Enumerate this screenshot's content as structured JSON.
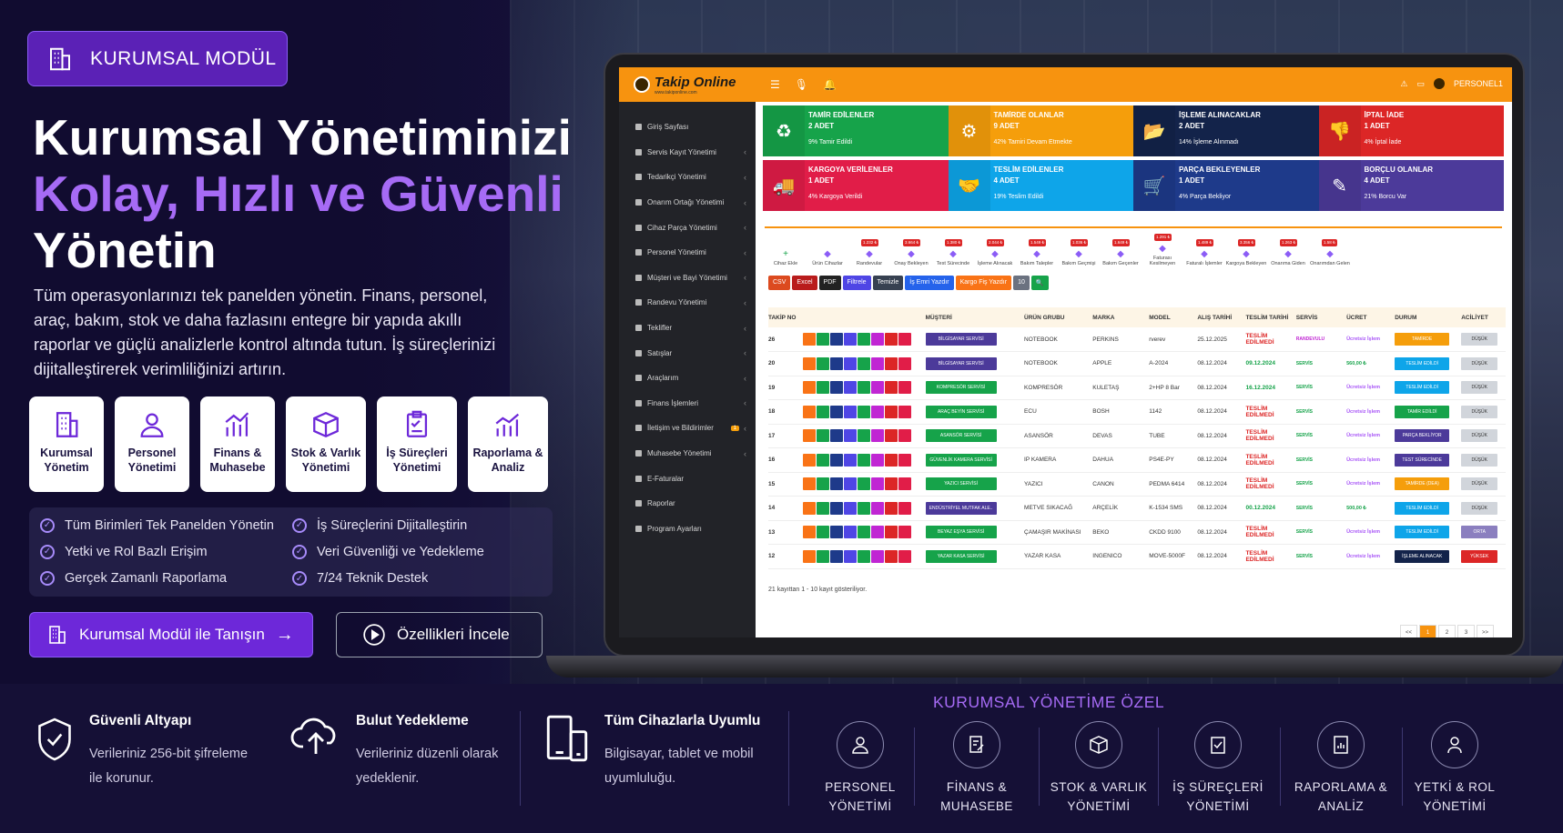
{
  "hero": {
    "badge": "KURUMSAL MODÜL",
    "headline_1": "Kurumsal Yönetiminizi",
    "headline_2": "Kolay, Hızlı ve Güvenli",
    "headline_3": "Yönetin",
    "description": "Tüm operasyonlarınızı tek panelden yönetin. Finans, personel, araç, bakım, stok ve daha fazlasını entegre bir yapıda akıllı raporlar ve güçlü analizlerle kontrol altında tutun. İş süreçlerinizi dijitalleştirerek verimliliğinizi artırın.",
    "cards": [
      {
        "l1": "Kurumsal",
        "l2": "Yönetim"
      },
      {
        "l1": "Personel",
        "l2": "Yönetimi"
      },
      {
        "l1": "Finans &",
        "l2": "Muhasebe"
      },
      {
        "l1": "Stok & Varlık",
        "l2": "Yönetimi"
      },
      {
        "l1": "İş Süreçleri",
        "l2": "Yönetimi"
      },
      {
        "l1": "Raporlama &",
        "l2": "Analiz"
      }
    ],
    "checks": [
      "Tüm Birimleri Tek Panelden Yönetin",
      "İş Süreçlerini Dijitalleştirin",
      "Yetki ve Rol Bazlı Erişim",
      "Veri Güvenliği ve Yedekleme",
      "Gerçek Zamanlı Raporlama",
      "7/24 Teknik Destek"
    ],
    "cta_primary": "Kurumsal Modül ile Tanışın",
    "cta_secondary": "Özellikleri İncele"
  },
  "app": {
    "brand": "Takip Online",
    "brand_sub": "www.takiponline.com",
    "user": "PERSONEL1",
    "sidebar": [
      "Giriş Sayfası",
      "Servis Kayıt Yönetimi",
      "Tedarikçi Yönetimi",
      "Onarım Ortağı Yönetimi",
      "Cihaz Parça Yönetimi",
      "Personel Yönetimi",
      "Müşteri ve Bayi Yönetimi",
      "Randevu Yönetimi",
      "Teklifler",
      "Satışlar",
      "Araçlarım",
      "Finans İşlemleri",
      "İletişim ve Bildirimler",
      "Muhasebe Yönetimi",
      "E-Faturalar",
      "Raporlar",
      "Program Ayarları"
    ],
    "stats": [
      {
        "title": "TAMİR EDİLENLER",
        "count": "2 ADET",
        "note": "9% Tamir Edildi",
        "color": "#16a34a",
        "icon": "♻"
      },
      {
        "title": "TAMİRDE OLANLAR",
        "count": "9 ADET",
        "note": "42% Tamiri Devam Etmekte",
        "color": "#f59e0b",
        "icon": "⚙"
      },
      {
        "title": "İŞLEME ALINACAKLAR",
        "count": "2 ADET",
        "note": "14% İşleme Alınmadı",
        "color": "#13234a",
        "icon": "📂"
      },
      {
        "title": "İPTAL İADE",
        "count": "1 ADET",
        "note": "4% İptal İade",
        "color": "#dc2626",
        "icon": "👎"
      },
      {
        "title": "KARGOYA VERİLENLER",
        "count": "1 ADET",
        "note": "4% Kargoya Verildi",
        "color": "#e11d48",
        "icon": "🚚"
      },
      {
        "title": "TESLİM EDİLENLER",
        "count": "4 ADET",
        "note": "19% Teslim Edildi",
        "color": "#0ea5e9",
        "icon": "🤝"
      },
      {
        "title": "PARÇA BEKLEYENLER",
        "count": "1 ADET",
        "note": "4% Parça Bekliyor",
        "color": "#1e3a8a",
        "icon": "🛒"
      },
      {
        "title": "BORÇLU OLANLAR",
        "count": "4 ADET",
        "note": "21% Borcu Var",
        "color": "#4c3a9a",
        "icon": "✎"
      }
    ],
    "tools": [
      {
        "label": "Cihaz Ekle",
        "badge": ""
      },
      {
        "label": "Ürün Cihazlar",
        "badge": ""
      },
      {
        "label": "Randevular",
        "badge": "1.232 ₺"
      },
      {
        "label": "Onay Bekleyen",
        "badge": "3.664 ₺"
      },
      {
        "label": "Test Sürecinde",
        "badge": "1.380 ₺"
      },
      {
        "label": "İşleme Alınacak",
        "badge": "2.044 ₺"
      },
      {
        "label": "Bakım Talepler",
        "badge": "1.549 ₺"
      },
      {
        "label": "Bakım Geçmişi",
        "badge": "1.036 ₺"
      },
      {
        "label": "Bakım Geçenler",
        "badge": "1.649 ₺"
      },
      {
        "label": "Faturası Kesilmeyen",
        "badge": "1.291 ₺"
      },
      {
        "label": "Faturalı İşlemler",
        "badge": "1.489 ₺"
      },
      {
        "label": "Kargoya Bekleyen",
        "badge": "3.356 ₺"
      },
      {
        "label": "Onarıma Giden",
        "badge": "1.263 ₺"
      },
      {
        "label": "Onarımdan Gelen",
        "badge": "1.58 ₺"
      }
    ],
    "exports": [
      {
        "label": "CSV",
        "color": "#dc4a1f"
      },
      {
        "label": "Excel",
        "color": "#b91c1c"
      },
      {
        "label": "PDF",
        "color": "#222"
      },
      {
        "label": "Filtrele",
        "color": "#4f46e5"
      },
      {
        "label": "Temizle",
        "color": "#374151"
      },
      {
        "label": "İş Emri Yazdır",
        "color": "#2563eb"
      },
      {
        "label": "Kargo Fiş Yazdır",
        "color": "#f97316"
      },
      {
        "label": "10",
        "color": "#6b7280"
      },
      {
        "label": "🔍",
        "color": "#16a34a"
      }
    ],
    "columns": [
      "TAKİP NO",
      "",
      "MÜŞTERİ",
      "ÜRÜN GRUBU",
      "MARKA",
      "MODEL",
      "ALIŞ TARİHİ",
      "TESLİM TARİHİ",
      "SERVİS",
      "ÜCRET",
      "DURUM",
      "ACİLİYET"
    ],
    "rows": [
      {
        "no": "26",
        "customer": "BİLGİSAYAR SERVİSİ",
        "ccolor": "#4c3a9a",
        "group": "NOTEBOOK",
        "brand": "PERKINS",
        "model": "rverev",
        "date": "25.12.2025",
        "delivery": "TESLİM EDİLMEDİ",
        "dcolor": "#dc2626",
        "service": "RANDEVULU",
        "scolor": "#c026d3",
        "fee": "Ücretsiz İşlem",
        "fcolor": "#a855f7",
        "status": "TAMİRDE",
        "stcolor": "#f59e0b",
        "priority": "DÜŞÜK",
        "pcolor": "#d1d5db"
      },
      {
        "no": "20",
        "customer": "BİLGİSAYAR SERVİSİ",
        "ccolor": "#4c3a9a",
        "group": "NOTEBOOK",
        "brand": "APPLE",
        "model": "A-2024",
        "date": "08.12.2024",
        "delivery": "09.12.2024",
        "dcolor": "#16a34a",
        "service": "SERVİS",
        "scolor": "#16a34a",
        "fee": "560,00 ₺",
        "fcolor": "#16a34a",
        "status": "TESLİM EDİLDİ",
        "stcolor": "#0ea5e9",
        "priority": "DÜŞÜK",
        "pcolor": "#d1d5db"
      },
      {
        "no": "19",
        "customer": "KOMPRESÖR SERVİSİ",
        "ccolor": "#16a34a",
        "group": "KOMPRESÖR",
        "brand": "KULETAŞ",
        "model": "2+HP 8 Bar",
        "date": "08.12.2024",
        "delivery": "16.12.2024",
        "dcolor": "#16a34a",
        "service": "SERVİS",
        "scolor": "#16a34a",
        "fee": "Ücretsiz İşlem",
        "fcolor": "#a855f7",
        "status": "TESLİM EDİLDİ",
        "stcolor": "#0ea5e9",
        "priority": "DÜŞÜK",
        "pcolor": "#d1d5db"
      },
      {
        "no": "18",
        "customer": "ARAÇ BEYİN SERVİSİ",
        "ccolor": "#16a34a",
        "group": "ECU",
        "brand": "BOSH",
        "model": "1142",
        "date": "08.12.2024",
        "delivery": "TESLİM EDİLMEDİ",
        "dcolor": "#dc2626",
        "service": "SERVİS",
        "scolor": "#16a34a",
        "fee": "Ücretsiz İşlem",
        "fcolor": "#a855f7",
        "status": "TAMİR EDİLDİ",
        "stcolor": "#16a34a",
        "priority": "DÜŞÜK",
        "pcolor": "#d1d5db"
      },
      {
        "no": "17",
        "customer": "ASANSÖR SERVİSİ",
        "ccolor": "#16a34a",
        "group": "ASANSÖR",
        "brand": "DEVAS",
        "model": "TUBE",
        "date": "08.12.2024",
        "delivery": "TESLİM EDİLMEDİ",
        "dcolor": "#dc2626",
        "service": "SERVİS",
        "scolor": "#16a34a",
        "fee": "Ücretsiz İşlem",
        "fcolor": "#a855f7",
        "status": "PARÇA BEKLİYOR",
        "stcolor": "#4c3a9a",
        "priority": "DÜŞÜK",
        "pcolor": "#d1d5db"
      },
      {
        "no": "16",
        "customer": "GÜVENLİK KAMERA SERVİSİ",
        "ccolor": "#16a34a",
        "group": "IP KAMERA",
        "brand": "DAHUA",
        "model": "PS4E-PY",
        "date": "08.12.2024",
        "delivery": "TESLİM EDİLMEDİ",
        "dcolor": "#dc2626",
        "service": "SERVİS",
        "scolor": "#16a34a",
        "fee": "Ücretsiz İşlem",
        "fcolor": "#a855f7",
        "status": "TEST SÜRECİNDE",
        "stcolor": "#4c3a9a",
        "priority": "DÜŞÜK",
        "pcolor": "#d1d5db"
      },
      {
        "no": "15",
        "customer": "YAZICI SERVİSİ",
        "ccolor": "#16a34a",
        "group": "YAZICI",
        "brand": "CANON",
        "model": "PEDMA 6414",
        "date": "08.12.2024",
        "delivery": "TESLİM EDİLMEDİ",
        "dcolor": "#dc2626",
        "service": "SERVİS",
        "scolor": "#16a34a",
        "fee": "Ücretsiz İşlem",
        "fcolor": "#a855f7",
        "status": "TAMİRDE (DEA)",
        "stcolor": "#f59e0b",
        "priority": "DÜŞÜK",
        "pcolor": "#d1d5db"
      },
      {
        "no": "14",
        "customer": "ENDÜSTRİYEL MUTFAK ALE..",
        "ccolor": "#4c3a9a",
        "group": "METVE SIKACAĞ",
        "brand": "ARÇELİK",
        "model": "K-1534 SMS",
        "date": "08.12.2024",
        "delivery": "00.12.2024",
        "dcolor": "#16a34a",
        "service": "SERVİS",
        "scolor": "#16a34a",
        "fee": "500,00 ₺",
        "fcolor": "#16a34a",
        "status": "TESLİM EDİLDİ",
        "stcolor": "#0ea5e9",
        "priority": "DÜŞÜK",
        "pcolor": "#d1d5db"
      },
      {
        "no": "13",
        "customer": "BEYAZ EŞYA SERVİSİ",
        "ccolor": "#16a34a",
        "group": "ÇAMAŞIR MAKİNASI",
        "brand": "BEKO",
        "model": "CKDD 9100",
        "date": "08.12.2024",
        "delivery": "TESLİM EDİLMEDİ",
        "dcolor": "#dc2626",
        "service": "SERVİS",
        "scolor": "#16a34a",
        "fee": "Ücretsiz İşlem",
        "fcolor": "#a855f7",
        "status": "TESLİM EDİLDİ",
        "stcolor": "#0ea5e9",
        "priority": "ORTA",
        "pcolor": "#8b7fbf"
      },
      {
        "no": "12",
        "customer": "YAZAR KASA SERVİSİ",
        "ccolor": "#16a34a",
        "group": "YAZAR KASA",
        "brand": "INGENICO",
        "model": "MOVE-5000F",
        "date": "08.12.2024",
        "delivery": "TESLİM EDİLMEDİ",
        "dcolor": "#dc2626",
        "service": "SERVİS",
        "scolor": "#16a34a",
        "fee": "Ücretsiz İşlem",
        "fcolor": "#a855f7",
        "status": "İŞLEME ALINACAK",
        "stcolor": "#13234a",
        "priority": "YÜKSEK",
        "pcolor": "#dc2626"
      }
    ],
    "footer": "21 kayıttan 1 - 10 kayıt gösteriliyor.",
    "pager": [
      "<<",
      "1",
      "2",
      "3",
      ">>"
    ]
  },
  "bottom": {
    "features": [
      {
        "title": "Güvenli Altyapı",
        "l1": "Verileriniz 256-bit şifreleme",
        "l2": "ile korunur."
      },
      {
        "title": "Bulut Yedekleme",
        "l1": "Verileriniz düzenli olarak",
        "l2": "yedeklenir."
      },
      {
        "title": "Tüm Cihazlarla Uyumlu",
        "l1": "Bilgisayar, tablet ve mobil",
        "l2": "uyumluluğu."
      }
    ],
    "kys_title": "KURUMSAL YÖNETİME ÖZEL",
    "modules": [
      {
        "l1": "PERSONEL",
        "l2": "YÖNETİMİ"
      },
      {
        "l1": "FİNANS &",
        "l2": "MUHASEBE"
      },
      {
        "l1": "STOK & VARLIK",
        "l2": "YÖNETİMİ"
      },
      {
        "l1": "İŞ SÜREÇLERİ",
        "l2": "YÖNETİMİ"
      },
      {
        "l1": "RAPORLAMA &",
        "l2": "ANALİZ"
      },
      {
        "l1": "YETKİ & ROL",
        "l2": "YÖNETİMİ"
      }
    ]
  }
}
